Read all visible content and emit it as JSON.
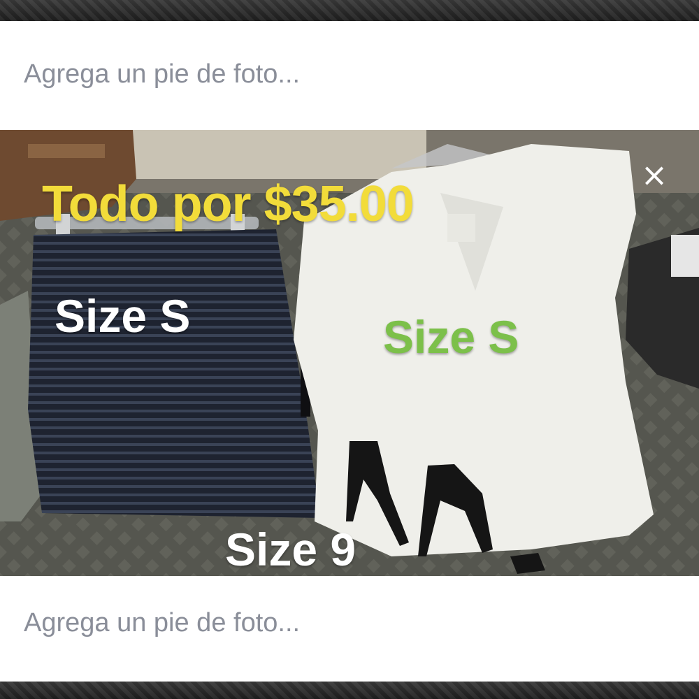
{
  "caption_top": {
    "placeholder": "Agrega un pie de foto..."
  },
  "photo": {
    "price_text": "Todo por $35.00",
    "skirt_size": "Size S",
    "top_size": "Size S",
    "shoe_size": "Size 9",
    "close_icon": "×",
    "colors": {
      "price": "#f2dc3a",
      "skirt_size": "#ffffff",
      "top_size": "#7cc04a",
      "shoe_size": "#ffffff"
    }
  },
  "caption_bottom": {
    "placeholder": "Agrega un pie de foto..."
  }
}
